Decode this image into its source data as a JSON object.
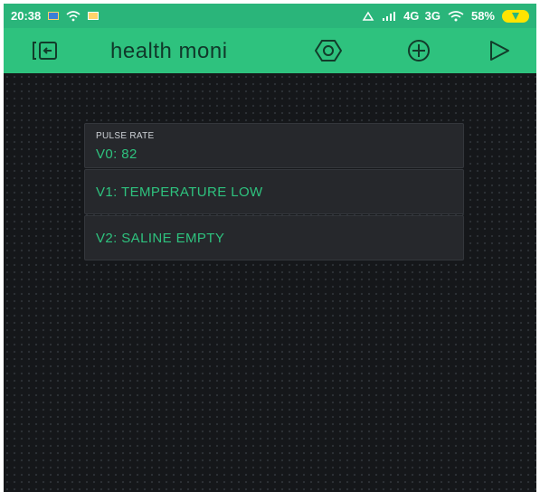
{
  "status_bar": {
    "time": "20:38",
    "network": "4G  3G",
    "battery": "58%"
  },
  "app_bar": {
    "title": "health moni"
  },
  "widgets": [
    {
      "label": "PULSE RATE",
      "value": "V0: 82"
    },
    {
      "label": "",
      "value": "V1: TEMPERATURE LOW"
    },
    {
      "label": "",
      "value": "V2: SALINE EMPTY"
    }
  ],
  "colors": {
    "accent": "#2ec27e",
    "canvas": "#15171a",
    "widget_bg": "#26282c",
    "value_text": "#2ec27e"
  }
}
